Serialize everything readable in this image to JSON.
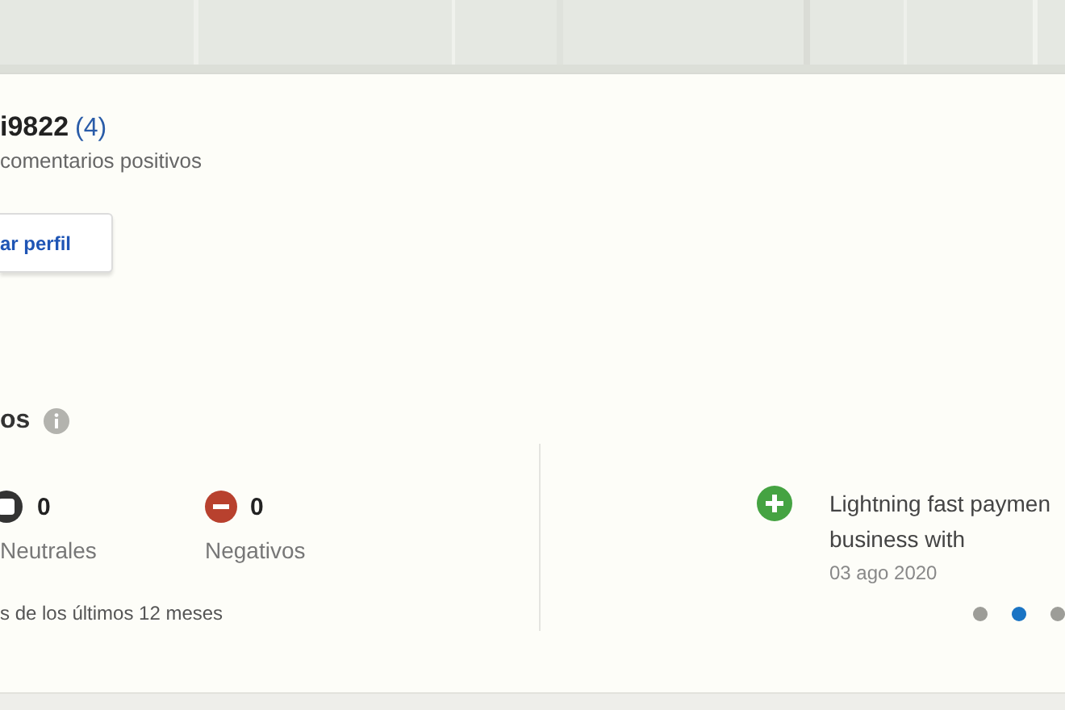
{
  "profile": {
    "username": "i9822",
    "count": "(4)",
    "subtitle": "comentarios positivos",
    "button": "ar perfil"
  },
  "feedback": {
    "title": "os",
    "counts": [
      {
        "kind": "neutral",
        "value": "0",
        "label": "Neutrales"
      },
      {
        "kind": "negative",
        "value": "0",
        "label": "Negativos"
      }
    ],
    "note": "s de los últimos 12 meses",
    "comment": {
      "kind": "positive",
      "lines": [
        "Lightning fast paymen",
        "business with"
      ],
      "date": "03 ago 2020"
    },
    "pager": [
      {
        "selected": false
      },
      {
        "selected": true
      },
      {
        "selected": false
      }
    ]
  }
}
